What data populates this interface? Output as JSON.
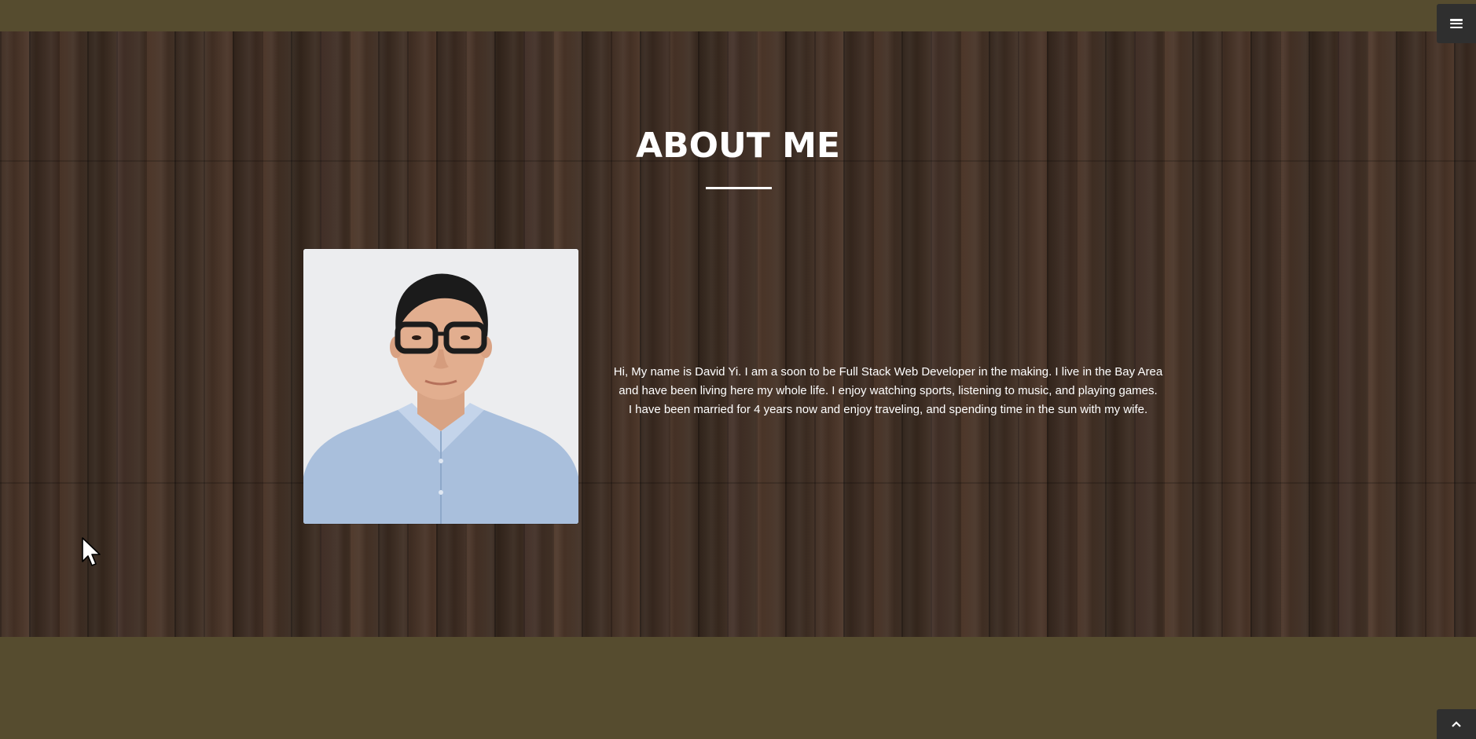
{
  "about": {
    "title": "ABOUT ME",
    "photo_alt": "Profile photo of David Yi",
    "bio_lines": [
      "Hi, My name is David Yi. I am a soon to be Full Stack Web Developer in the making. I live in the Bay Area",
      "and have been living here my whole life. I enjoy watching sports, listening to music, and playing games.",
      "I have been married for 4 years now and enjoy traveling, and spending time in the sun with my wife."
    ]
  },
  "header": {
    "menu_icon": "hamburger-menu-icon"
  },
  "footer": {
    "scroll_icon": "chevron-up-icon"
  },
  "colors": {
    "band": "#564c2f",
    "wood": "#3b2a20",
    "button": "#2f2f2f",
    "text": "#ffffff"
  }
}
